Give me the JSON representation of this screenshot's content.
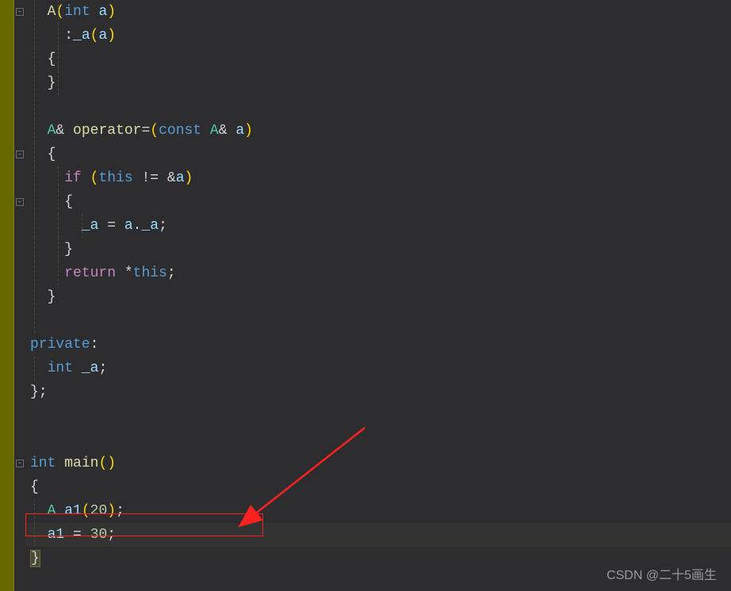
{
  "lines": {
    "l0_A": "A",
    "l0_int": "int",
    "l0_a": "a",
    "l1_a": "_a",
    "l1_p": "a",
    "l4_A": "A",
    "l4_op": "operator",
    "l4_eq": "=",
    "l4_const": "const",
    "l4_A2": "A",
    "l4_amp": "&",
    "l4_a": "a",
    "l6_if": "if",
    "l6_this": "this",
    "l6_ne": "!=",
    "l6_amp": "&",
    "l6_a": "a",
    "l8_a": "_a",
    "l8_eq": "=",
    "l8_aa": "a",
    "l8_dot": ".",
    "l8_a2": "_a",
    "l10_return": "return",
    "l10_star": "*",
    "l10_this": "this",
    "l12_private": "private",
    "l13_int": "int",
    "l13_a": "_a",
    "l15_int": "int",
    "l15_main": "main",
    "l17_A": "A",
    "l17_a1": "a1",
    "l17_20": "20",
    "l18_a1": "a1",
    "l18_30": "30"
  },
  "watermark": "CSDN @二十5画生",
  "fold_glyph": "-"
}
